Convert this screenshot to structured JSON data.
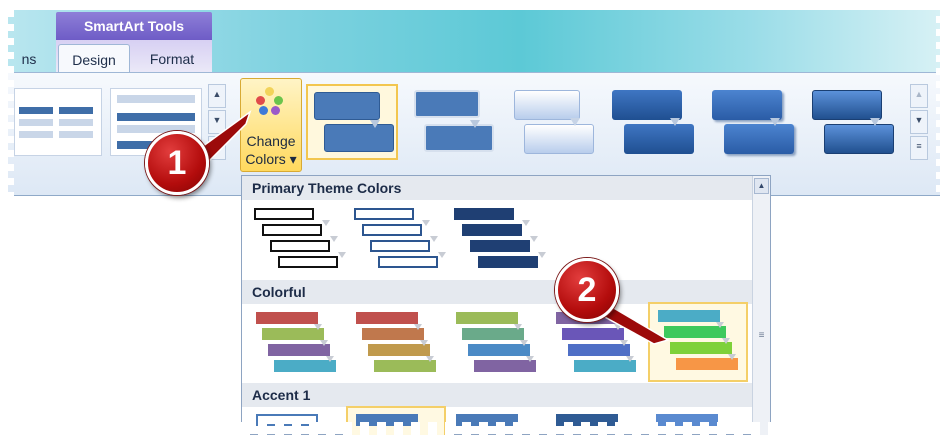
{
  "ribbon": {
    "contextual_group": "SmartArt Tools",
    "tabs": [
      {
        "label": "ns"
      },
      {
        "label": "Design",
        "selected": true
      },
      {
        "label": "Format"
      }
    ],
    "change_colors": {
      "line1": "Change",
      "line2": "Colors ▾",
      "icon": "color-palette-icon"
    }
  },
  "dropdown": {
    "sections": [
      {
        "title": "Primary Theme Colors"
      },
      {
        "title": "Colorful"
      },
      {
        "title": "Accent 1"
      }
    ]
  },
  "callouts": {
    "first": "1",
    "second": "2"
  },
  "colors": {
    "ribbon_accent": "#5cc9d6",
    "contextual_tab": "#7a68cc",
    "selection_highlight": "#f4cf68",
    "callout_red": "#b30c0c",
    "theme_blue": "#3f6ea8"
  }
}
